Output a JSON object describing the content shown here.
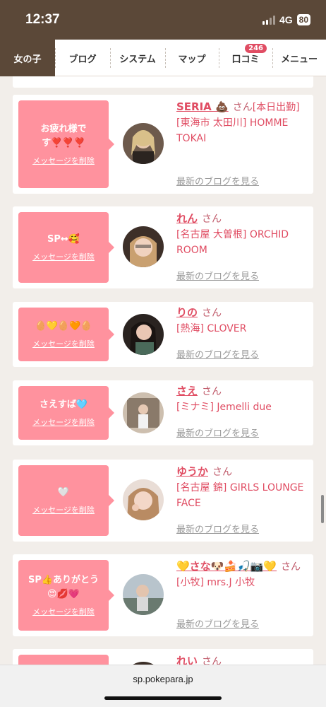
{
  "status": {
    "time": "12:37",
    "network": "4G",
    "battery": "80"
  },
  "nav": {
    "items": [
      {
        "label": "女の子",
        "active": true
      },
      {
        "label": "ブログ"
      },
      {
        "label": "システム"
      },
      {
        "label": "マップ"
      },
      {
        "label": "口コミ",
        "badge": "246"
      },
      {
        "label": "メニュー"
      }
    ]
  },
  "cards": [
    {
      "message": "お疲れ様です❣️❣️❣️",
      "delete_label": "メッセージを削除",
      "name": "SERIA 💩",
      "honorific": "さん",
      "note": "[本日出勤]",
      "shop": "[東海市 太田川] HOMME TOKAI",
      "blog_link": "最新のブログを見る"
    },
    {
      "message": "SP↔🥰",
      "delete_label": "メッセージを削除",
      "name": "れん",
      "honorific": "さん",
      "note": "",
      "shop": "[名古屋 大曽根] ORCHID ROOM",
      "blog_link": "最新のブログを見る"
    },
    {
      "message": "🥚💛🥚🧡🥚",
      "delete_label": "メッセージを削除",
      "name": "りの",
      "honorific": "さん",
      "note": "",
      "shop": "[熱海] CLOVER",
      "blog_link": "最新のブログを見る"
    },
    {
      "message": "さえすば🩵",
      "delete_label": "メッセージを削除",
      "name": "さえ",
      "honorific": "さん",
      "note": "",
      "shop": "[ミナミ] Jemelli due",
      "blog_link": "最新のブログを見る"
    },
    {
      "message": "🤍",
      "delete_label": "メッセージを削除",
      "name": "ゆうか",
      "honorific": "さん",
      "note": "",
      "shop": "[名古屋 錦] GIRLS LOUNGE FACE",
      "blog_link": "最新のブログを見る"
    },
    {
      "message": "SP👍ありがとう😍💋💗",
      "delete_label": "メッセージを削除",
      "name": "💛さな🐶🍰🎣📷💛",
      "honorific": "さん",
      "note": "",
      "shop": "[小牧] mrs.J 小牧",
      "blog_link": "最新のブログを見る"
    },
    {
      "message": "",
      "delete_label": "",
      "name": "れい",
      "honorific": "さん",
      "note": "",
      "shop": "",
      "blog_link": ""
    }
  ],
  "url": "sp.pokepara.jp",
  "colors": {
    "brand_brown": "#5b4838",
    "bubble_pink": "#ff929e",
    "accent_pink": "#e04d63"
  }
}
